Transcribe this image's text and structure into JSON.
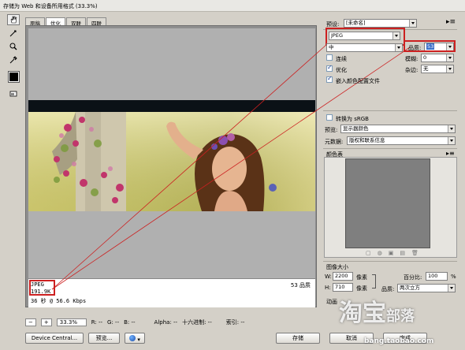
{
  "window": {
    "title": "存储为 Web 和设备所用格式 (33.3%)"
  },
  "tabs": [
    {
      "label": "原稿"
    },
    {
      "label": "优化"
    },
    {
      "label": "双联"
    },
    {
      "label": "四联"
    }
  ],
  "preview": {
    "format": "JPEG",
    "size": "191.9K",
    "time": "36 秒 @ 56.6 Kbps",
    "quality_label": "53 品质"
  },
  "statusbar": {
    "zoom": "33.3%",
    "r": "R: --",
    "g": "G: --",
    "b": "B: --",
    "alpha": "Alpha: --",
    "hex": "十六进制: --",
    "index": "索引: --"
  },
  "buttons": {
    "device_central": "Device Central...",
    "preview": "预览...",
    "save": "存储",
    "cancel": "取消",
    "done": "完成"
  },
  "settings": {
    "preset_label": "预设:",
    "preset_value": "[未命名]",
    "format_value": "JPEG",
    "quality_level": "中",
    "quality_label": "品质:",
    "quality_value": "53",
    "progressive": "连续",
    "blur_label": "模糊:",
    "blur_value": "0",
    "optimized": "优化",
    "matte_label": "杂边:",
    "matte_value": "无",
    "embed_profile": "嵌入颜色配置文件",
    "convert_srgb": "转换为 sRGB",
    "preview_label": "预览:",
    "preview_value": "显示器颜色",
    "metadata_label": "元数据:",
    "metadata_value": "版权和联系信息",
    "color_table": "颜色表",
    "image_size": "图像大小",
    "w_label": "W:",
    "w_value": "2200",
    "h_label": "H:",
    "h_value": "710",
    "pixel_unit": "像素",
    "percent_label": "百分比:",
    "percent_value": "100",
    "percent_unit": "%",
    "quality2_label": "品质:",
    "quality2_value": "两次立方",
    "animation": "动画"
  },
  "watermark": {
    "main": "淘宝",
    "sub": "部落",
    "url": "bang.taobao.com"
  },
  "colors": {
    "highlight": "#cc2020",
    "dialog_bg": "#d4d0c8"
  }
}
